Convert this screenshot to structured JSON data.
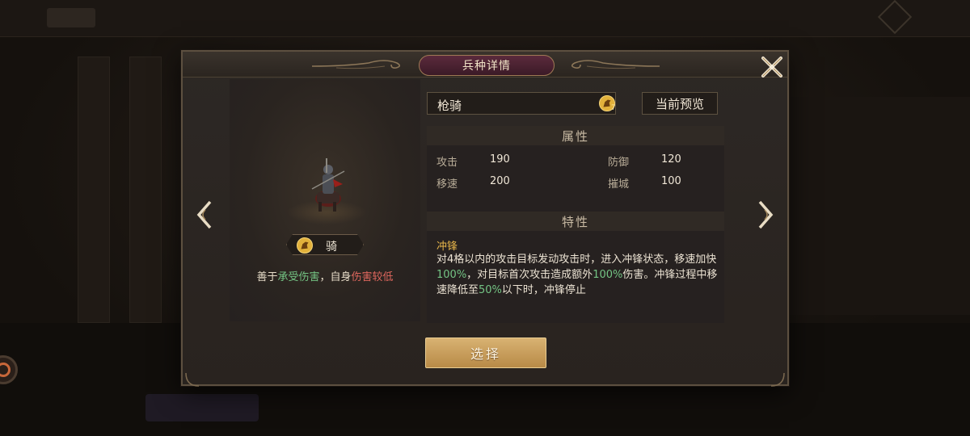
{
  "dialog": {
    "title": "兵种详情",
    "unit_name": "枪骑",
    "unit_icon_badge": "7",
    "preview_button": "当前预览",
    "select_button": "选择"
  },
  "unit_type": {
    "label": "骑",
    "desc_prefix": "善于",
    "desc_strength": "承受伤害",
    "desc_middle": "，自身",
    "desc_weakness": "伤害较低"
  },
  "attributes": {
    "heading": "属性",
    "attack_label": "攻击",
    "attack_value": "190",
    "defense_label": "防御",
    "defense_value": "120",
    "speed_label": "移速",
    "speed_value": "200",
    "siege_label": "摧城",
    "siege_value": "100"
  },
  "traits": {
    "heading": "特性",
    "name": "冲锋",
    "text1": "对4格以内的攻击目标发动攻击时，进入冲锋状态，移速加快",
    "v1": "100%",
    "text2": "，对目标首次攻击造成额外",
    "v2": "100%",
    "text3": "伤害。冲锋过程中移速降低至",
    "v3": "50%",
    "text4": "以下时，冲锋停止"
  },
  "colors": {
    "highlight_green": "#74c484",
    "highlight_red": "#e0675e",
    "trait_gold": "#e6b54a",
    "button_gold": "#c99d58"
  },
  "icons": [
    "close-icon",
    "horse-icon",
    "left-arrow-icon",
    "right-arrow-icon"
  ]
}
